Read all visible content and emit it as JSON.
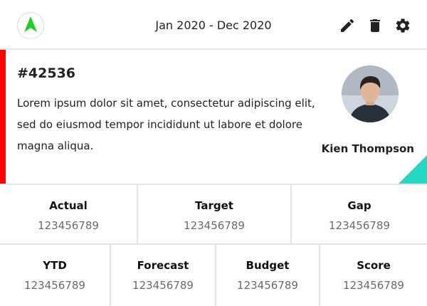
{
  "header": {
    "logo_icon": "green-arrow-up-icon",
    "period": "Jan 2020 - Dec 2020",
    "actions": [
      {
        "icon": "pencil-icon"
      },
      {
        "icon": "trash-icon"
      },
      {
        "icon": "gear-icon"
      }
    ]
  },
  "card": {
    "ticket_id": "#42536",
    "description": "Lorem ipsum dolor sit amet, consectetur adipiscing elit, sed do eiusmod tempor incididunt ut labore et dolore magna aliqua.",
    "person_name": "Kien Thompson",
    "accent_color": "#ff0000",
    "corner_color": "#22d9c3"
  },
  "stats_row1": [
    {
      "label": "Actual",
      "value": "123456789"
    },
    {
      "label": "Target",
      "value": "123456789"
    },
    {
      "label": "Gap",
      "value": "123456789"
    }
  ],
  "stats_row2": [
    {
      "label": "YTD",
      "value": "123456789"
    },
    {
      "label": "Forecast",
      "value": "123456789"
    },
    {
      "label": "Budget",
      "value": "123456789"
    },
    {
      "label": "Score",
      "value": "123456789"
    }
  ]
}
